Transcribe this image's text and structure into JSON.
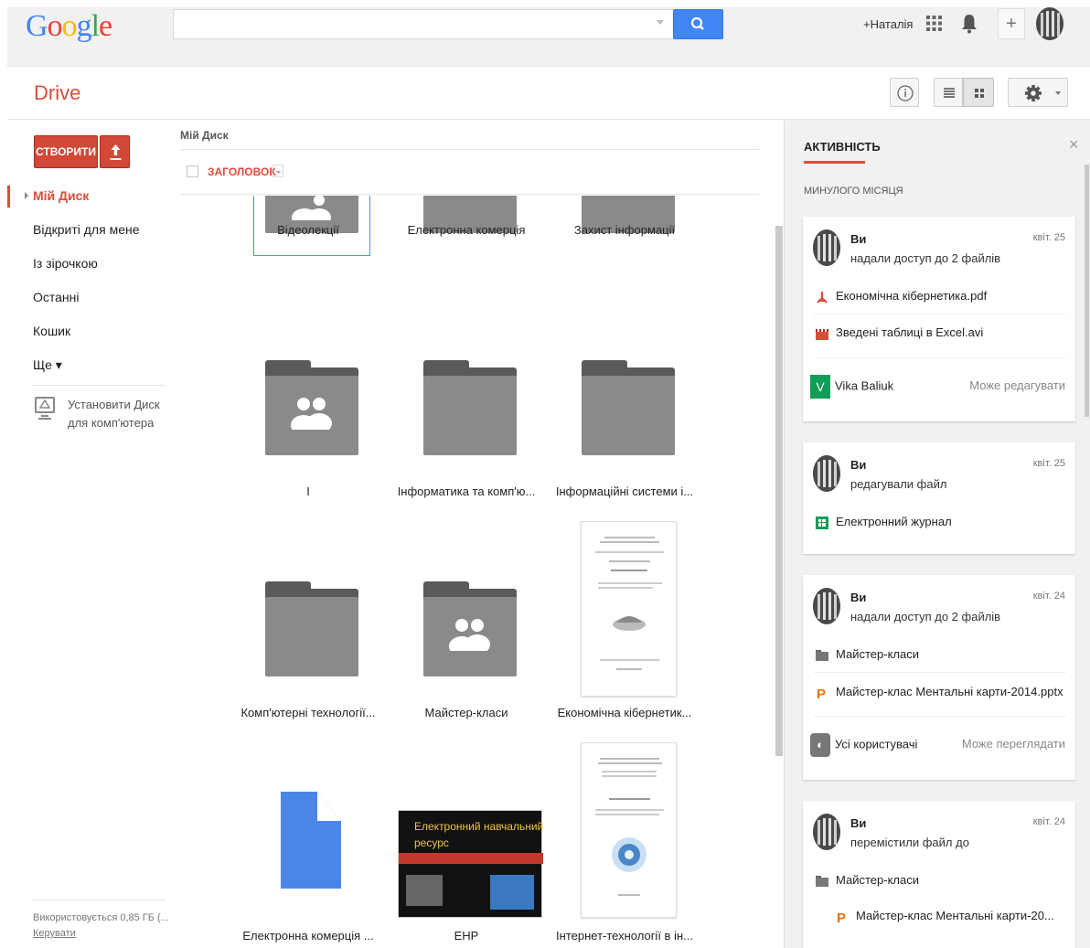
{
  "header": {
    "logo": "Google",
    "search": {
      "value": "",
      "placeholder": ""
    },
    "user_name": "+Наталія"
  },
  "toolbar": {
    "app_title": "Drive",
    "create_label": "СТВОРИТИ"
  },
  "sidebar": {
    "items": [
      {
        "label": "Мій Диск",
        "active": true
      },
      {
        "label": "Відкриті для мене"
      },
      {
        "label": "Із зірочкою"
      },
      {
        "label": "Останні"
      },
      {
        "label": "Кошик"
      },
      {
        "label": "Ще ▾"
      }
    ],
    "install_label_1": "Установити Диск",
    "install_label_2": "для комп'ютера",
    "storage_text": "Використовується 0,85 ГБ (...",
    "manage_label": "Керувати"
  },
  "main": {
    "breadcrumb": "Мій Диск",
    "sort_label": "ЗАГОЛОВОК",
    "items": [
      {
        "label": "Відеолекції",
        "kind": "shared-folder"
      },
      {
        "label": "Електронна комерція",
        "kind": "folder"
      },
      {
        "label": "Захист інформації",
        "kind": "folder"
      },
      {
        "label": "І",
        "kind": "shared-folder"
      },
      {
        "label": "Інформатика та комп'ю...",
        "kind": "folder"
      },
      {
        "label": "Інформаційні системи і...",
        "kind": "folder"
      },
      {
        "label": "Комп'ютерні технології...",
        "kind": "folder"
      },
      {
        "label": "Майстер-класи",
        "kind": "shared-folder"
      },
      {
        "label": "Економічна кібернетик...",
        "kind": "document"
      },
      {
        "label": "Електронна комерція ...",
        "kind": "google-doc"
      },
      {
        "label": "ЕНР",
        "kind": "image"
      },
      {
        "label": "Інтернет-технології в ін...",
        "kind": "document"
      }
    ],
    "enr_thumb_line1": "Електронний навчальний",
    "enr_thumb_line2": "ресурс"
  },
  "activity": {
    "title": "АКТИВНІСТЬ",
    "period": "МИНУЛОГО МІСЯЦЯ",
    "cards": [
      {
        "who": "Ви",
        "date": "квіт. 25",
        "action": "надали доступ до 2 файлів",
        "files": [
          "Економічна кібернетика.pdf",
          "Зведені таблиці в Excel.avi"
        ],
        "person": "Vika Baliuk",
        "permission": "Може редагувати"
      },
      {
        "who": "Ви",
        "date": "квіт. 25",
        "action": "редагували файл",
        "files": [
          "Електронний журнал"
        ]
      },
      {
        "who": "Ви",
        "date": "квіт. 24",
        "action": "надали доступ до 2 файлів",
        "files": [
          "Майстер-класи",
          "Майстер-клас Ментальні карти-2014.pptx"
        ],
        "person": "Усі користувачі",
        "permission": "Може переглядати"
      },
      {
        "who": "Ви",
        "date": "квіт. 24",
        "action": "перемістили файл до",
        "files": [
          "Майстер-класи",
          "Майстер-клас Ментальні карти-20..."
        ]
      }
    ]
  },
  "colors": {
    "accent": "#dd4b39",
    "search_button": "#4285f4",
    "folder": "#8a8a8a"
  }
}
